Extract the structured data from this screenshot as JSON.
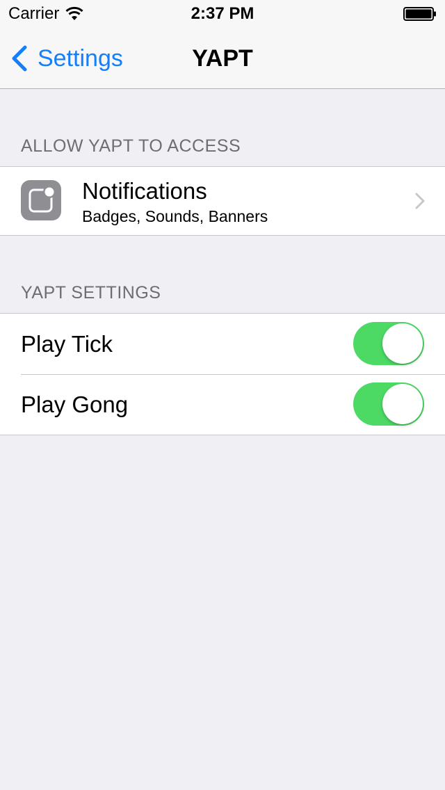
{
  "status_bar": {
    "carrier": "Carrier",
    "time": "2:37 PM"
  },
  "nav": {
    "back_label": "Settings",
    "title": "YAPT"
  },
  "sections": {
    "access": {
      "header": "ALLOW YAPT TO ACCESS",
      "notifications": {
        "title": "Notifications",
        "subtitle": "Badges, Sounds, Banners"
      }
    },
    "settings": {
      "header": "YAPT SETTINGS",
      "items": [
        {
          "label": "Play Tick",
          "on": true
        },
        {
          "label": "Play Gong",
          "on": true
        }
      ]
    }
  },
  "colors": {
    "accent": "#147efb",
    "toggle_on": "#4cd964",
    "background": "#efeff4"
  },
  "icons": {
    "back": "chevron-left-icon",
    "notifications": "notifications-icon",
    "disclosure": "chevron-right-icon"
  }
}
